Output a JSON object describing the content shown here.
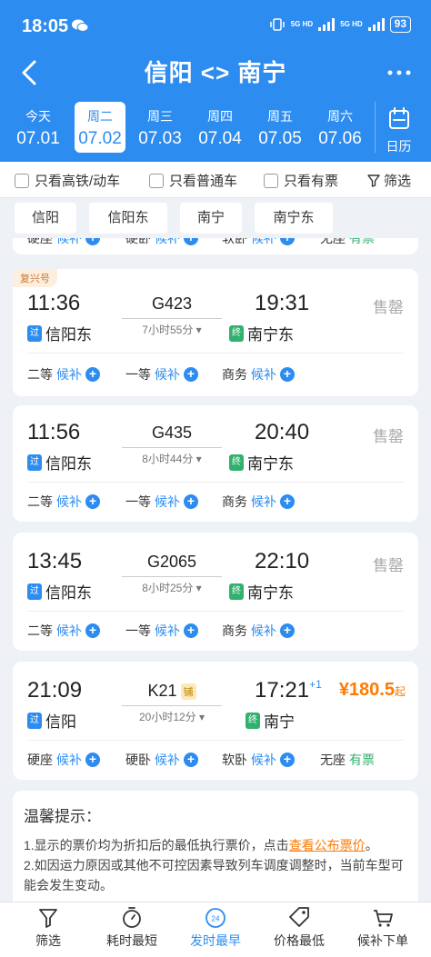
{
  "status": {
    "time": "18:05",
    "net1": "5G HD",
    "net2": "5G HD",
    "battery": "93"
  },
  "nav": {
    "title": "信阳 <> 南宁"
  },
  "dates": [
    {
      "week": "今天",
      "date": "07.01"
    },
    {
      "week": "周二",
      "date": "07.02",
      "active": true
    },
    {
      "week": "周三",
      "date": "07.03"
    },
    {
      "week": "周四",
      "date": "07.04"
    },
    {
      "week": "周五",
      "date": "07.05"
    },
    {
      "week": "周六",
      "date": "07.06"
    }
  ],
  "calendar_label": "日历",
  "filters": {
    "hsr": "只看高铁/动车",
    "normal": "只看普通车",
    "available": "只看有票",
    "screen": "筛选"
  },
  "stations": [
    "信阳",
    "信阳东",
    "南宁",
    "南宁东"
  ],
  "partial_row": {
    "s1": "硬座",
    "s1v": "候补",
    "s2": "硬卧",
    "s2v": "候补",
    "s3": "软卧",
    "s3v": "候补",
    "s4": "无座",
    "s4v": "有票"
  },
  "trains": [
    {
      "badge": "复兴号",
      "dep": "11:36",
      "arr": "19:31",
      "no": "G423",
      "dur": "7小时55分",
      "from": "信阳东",
      "to": "南宁东",
      "from_tag": "过",
      "to_tag": "终",
      "status": "售罄",
      "seats": [
        {
          "name": "二等",
          "state": "候补"
        },
        {
          "name": "一等",
          "state": "候补"
        },
        {
          "name": "商务",
          "state": "候补"
        }
      ]
    },
    {
      "dep": "11:56",
      "arr": "20:40",
      "no": "G435",
      "dur": "8小时44分",
      "from": "信阳东",
      "to": "南宁东",
      "from_tag": "过",
      "to_tag": "终",
      "status": "售罄",
      "seats": [
        {
          "name": "二等",
          "state": "候补"
        },
        {
          "name": "一等",
          "state": "候补"
        },
        {
          "name": "商务",
          "state": "候补"
        }
      ]
    },
    {
      "dep": "13:45",
      "arr": "22:10",
      "no": "G2065",
      "dur": "8小时25分",
      "from": "信阳东",
      "to": "南宁东",
      "from_tag": "过",
      "to_tag": "终",
      "status": "售罄",
      "seats": [
        {
          "name": "二等",
          "state": "候补"
        },
        {
          "name": "一等",
          "state": "候补"
        },
        {
          "name": "商务",
          "state": "候补"
        }
      ]
    },
    {
      "dep": "21:09",
      "arr": "17:21",
      "arr_plus": "+1",
      "no": "K21",
      "sleeper": "铺",
      "dur": "20小时12分",
      "from": "信阳",
      "to": "南宁",
      "from_tag": "过",
      "to_tag": "终",
      "price": "¥180.5",
      "price_suffix": "起",
      "seats": [
        {
          "name": "硬座",
          "state": "候补"
        },
        {
          "name": "硬卧",
          "state": "候补"
        },
        {
          "name": "软卧",
          "state": "候补"
        },
        {
          "name": "无座",
          "state": "有票"
        }
      ]
    }
  ],
  "tips": {
    "title": "温馨提示：",
    "line1_pre": "1.显示的票价均为折扣后的最低执行票价，点击",
    "line1_link": "查看公布票价",
    "line1_post": "。",
    "line2": "2.如因运力原因或其他不可控因素导致列车调度调整时，当前车型可能会发生变动。"
  },
  "tabs": [
    {
      "label": "筛选"
    },
    {
      "label": "耗时最短"
    },
    {
      "label": "发时最早",
      "active": true,
      "badge": "24"
    },
    {
      "label": "价格最低"
    },
    {
      "label": "候补下单"
    }
  ]
}
